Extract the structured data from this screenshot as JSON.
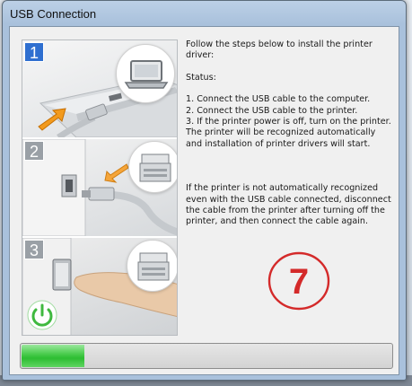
{
  "window": {
    "title": "USB Connection"
  },
  "steps": [
    {
      "number": "1"
    },
    {
      "number": "2"
    },
    {
      "number": "3"
    }
  ],
  "instructions": {
    "intro": "Follow the steps below to install the printer driver:",
    "status_label": "Status:",
    "step1": "1. Connect the USB cable to the computer.",
    "step2": "2. Connect the USB cable to the printer.",
    "step3": "3. If the printer power is off, turn on the printer.",
    "recognize": "The printer will be recognized automatically and installation of printer drivers will start.",
    "troubleshoot": "If the printer is not automatically recognized even with the USB cable connected, disconnect the cable from the printer after turning off the printer, and then connect the cable again."
  },
  "annotation": {
    "label": "7",
    "color": "#d42a2a"
  },
  "progress": {
    "fraction": 0.17,
    "color": "#2dbd32"
  },
  "icons": [
    "laptop-icon",
    "usb-plug-icon",
    "arrow-icon",
    "printer-icon",
    "power-icon"
  ]
}
